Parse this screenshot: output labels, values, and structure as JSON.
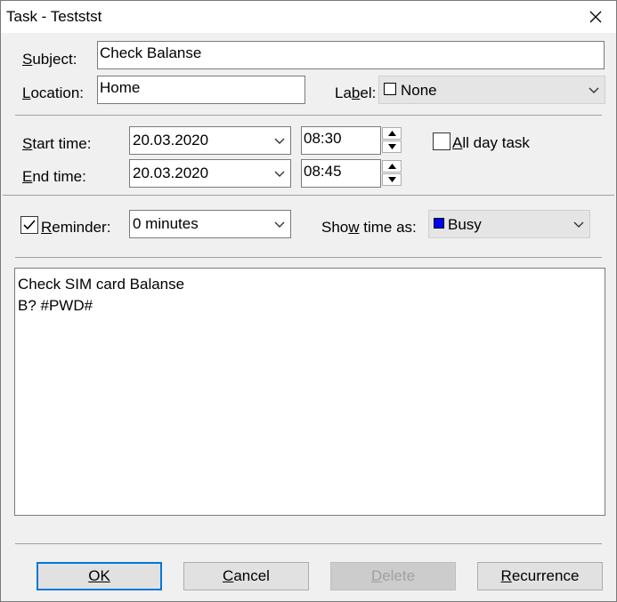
{
  "window": {
    "title": "Task - Teststst"
  },
  "subject": {
    "label": "Subject:",
    "value": "Check Balanse"
  },
  "location": {
    "label": "Location:",
    "value": "Home"
  },
  "label": {
    "label": "Label:",
    "value": "None"
  },
  "start": {
    "label": "Start time:",
    "date": "20.03.2020",
    "time": "08:30"
  },
  "end": {
    "label": "End time:",
    "date": "20.03.2020",
    "time": "08:45"
  },
  "all_day": {
    "label": "All day task",
    "checked": false
  },
  "reminder": {
    "label": "Reminder:",
    "checked": true,
    "value": "0 minutes"
  },
  "show_time_as": {
    "label": "Show time as:",
    "value": "Busy",
    "color": "#0000ff"
  },
  "notes": {
    "line1": "Check SIM card Balanse",
    "line2": "B? #PWD#"
  },
  "buttons": {
    "ok": "OK",
    "cancel": "Cancel",
    "delete": "Delete",
    "recurrence": "Recurrence"
  }
}
